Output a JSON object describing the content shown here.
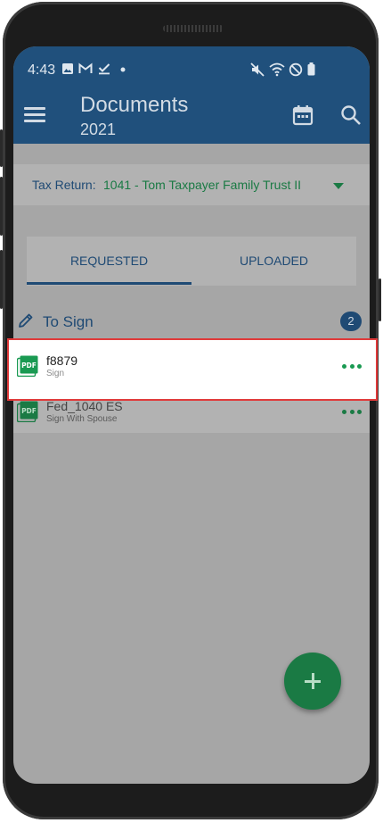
{
  "status_bar": {
    "time": "4:43",
    "left_icons": [
      "image-icon",
      "gmail-icon",
      "check-icon",
      "dot-icon"
    ],
    "right_icons": [
      "mute-icon",
      "wifi-icon",
      "dnd-icon",
      "battery-icon"
    ]
  },
  "app_bar": {
    "title": "Documents",
    "subtitle": "2021",
    "menu_icon": "menu-icon",
    "calendar_icon": "calendar-icon",
    "search_icon": "search-icon",
    "color": "#20507c"
  },
  "tax_return": {
    "label": "Tax Return:",
    "value": "1041 - Tom Taxpayer Family Trust II",
    "dropdown_icon": "caret-down-icon"
  },
  "tabs": [
    {
      "label": "REQUESTED",
      "active": true
    },
    {
      "label": "UPLOADED",
      "active": false
    }
  ],
  "section": {
    "title": "To Sign",
    "count": "2",
    "icon": "pencil-icon"
  },
  "documents": [
    {
      "name": "f8879",
      "subtitle": "Sign",
      "icon": "pdf-icon",
      "highlighted": true
    },
    {
      "name": "Fed_1040 ES",
      "subtitle": "Sign With Spouse",
      "icon": "pdf-icon",
      "highlighted": false
    }
  ],
  "fab": {
    "icon": "plus-icon",
    "color": "#1a7a44"
  },
  "colors": {
    "primary": "#1f4a74",
    "accent": "#1a7a44",
    "overlay": "#a6a6a6",
    "highlight_border": "#e03a3a"
  }
}
